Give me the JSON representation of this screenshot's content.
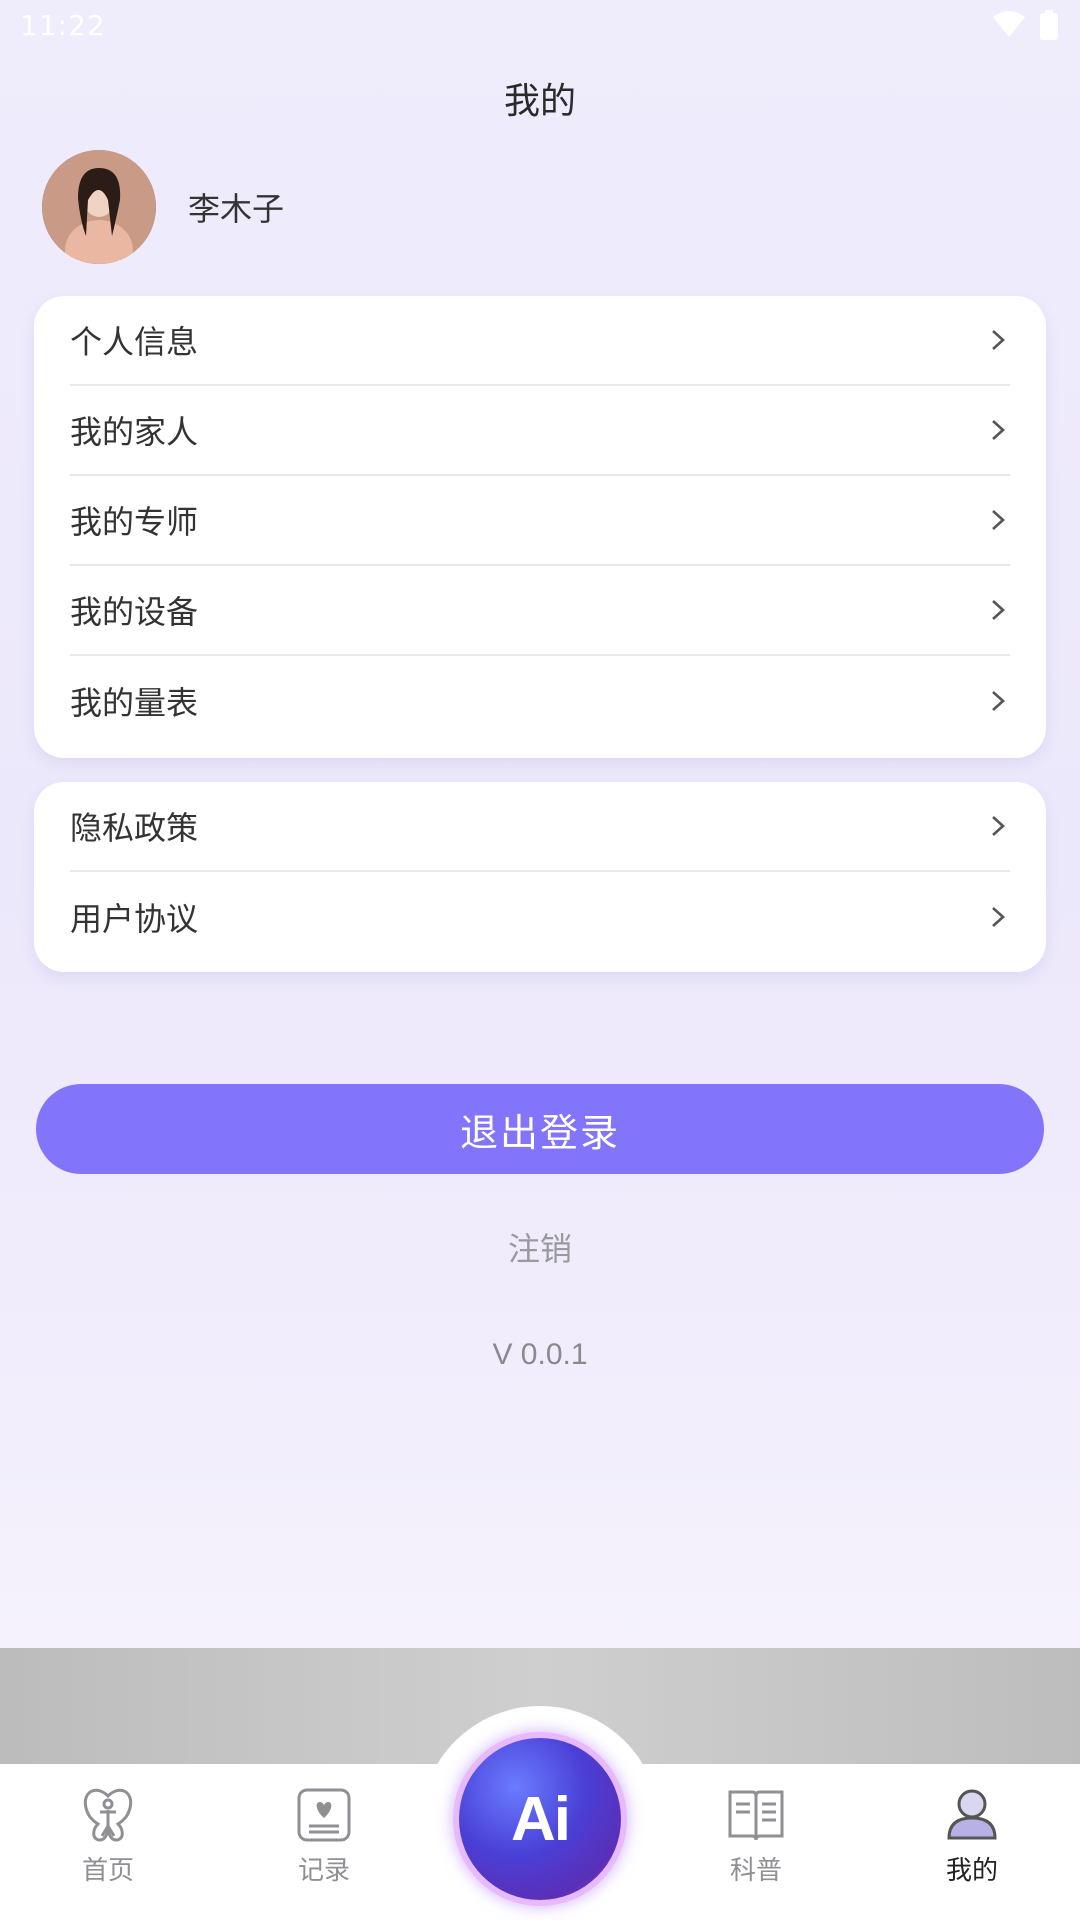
{
  "status_bar": {
    "time": "11:22"
  },
  "header": {
    "title": "我的"
  },
  "profile": {
    "name": "李木子"
  },
  "menu_group_1": [
    {
      "label": "个人信息"
    },
    {
      "label": "我的家人"
    },
    {
      "label": "我的专师"
    },
    {
      "label": "我的设备"
    },
    {
      "label": "我的量表"
    }
  ],
  "menu_group_2": [
    {
      "label": "隐私政策"
    },
    {
      "label": "用户协议"
    }
  ],
  "actions": {
    "logout_label": "退出登录",
    "deregister_label": "注销"
  },
  "version": "V 0.0.1",
  "tabs": [
    {
      "label": "首页",
      "icon": "home-icon"
    },
    {
      "label": "记录",
      "icon": "record-icon"
    },
    {
      "label": "Ai",
      "icon": "ai-icon"
    },
    {
      "label": "科普",
      "icon": "book-icon"
    },
    {
      "label": "我的",
      "icon": "profile-icon",
      "active": true
    }
  ],
  "colors": {
    "accent": "#8375fb",
    "background": "#efedfc"
  }
}
